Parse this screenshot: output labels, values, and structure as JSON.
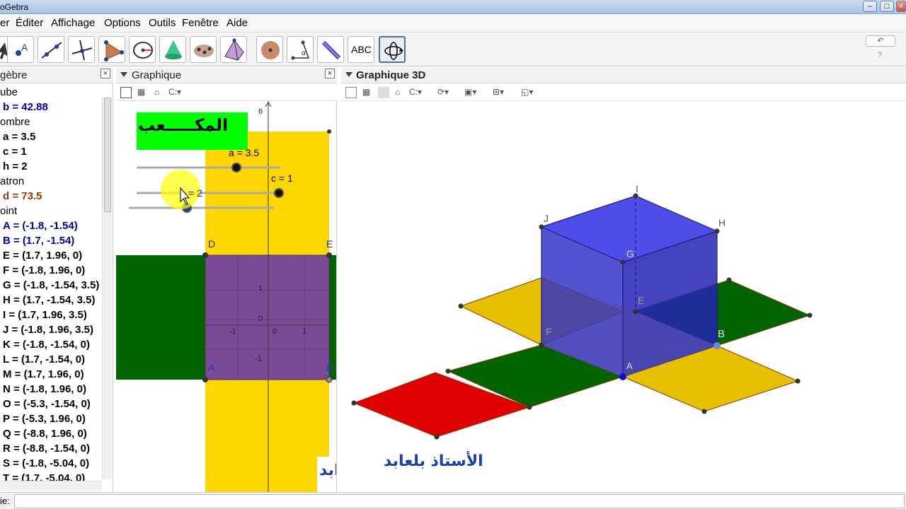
{
  "window": {
    "title": "oGebra"
  },
  "menu": [
    "er",
    "Éditer",
    "Affichage",
    "Options",
    "Outils",
    "Fenêtre",
    "Aide"
  ],
  "toolbar": {
    "abc_label": "ABC",
    "tools": [
      "move-tool",
      "point-tool",
      "line-tool",
      "perpendicular-tool",
      "polygon-tool",
      "circle-tool",
      "cone-tool",
      "conic-tool",
      "pyramid-tool",
      "sphere-tool",
      "angle-tool",
      "reflect-tool",
      "text-tool",
      "rotate-view-tool"
    ]
  },
  "algebra": {
    "title": "gèbre",
    "rows": [
      {
        "text": "ube",
        "style": "cat"
      },
      {
        "text": "b = 42.88",
        "style": "blue"
      },
      {
        "text": "ombre",
        "style": "cat"
      },
      {
        "text": "a = 3.5",
        "style": "black"
      },
      {
        "text": "c = 1",
        "style": "black"
      },
      {
        "text": "h = 2",
        "style": "black"
      },
      {
        "text": "atron",
        "style": "cat"
      },
      {
        "text": "d = 73.5",
        "style": "brown"
      },
      {
        "text": "oint",
        "style": "cat"
      },
      {
        "text": "A = (-1.8, -1.54)",
        "style": "blue"
      },
      {
        "text": "B = (1.7, -1.54)",
        "style": "blue"
      },
      {
        "text": "E = (1.7, 1.96, 0)",
        "style": "black"
      },
      {
        "text": "F = (-1.8, 1.96, 0)",
        "style": "black"
      },
      {
        "text": "G = (-1.8, -1.54, 3.5)",
        "style": "black"
      },
      {
        "text": "H = (1.7, -1.54, 3.5)",
        "style": "black"
      },
      {
        "text": "I = (1.7, 1.96, 3.5)",
        "style": "black"
      },
      {
        "text": "J = (-1.8, 1.96, 3.5)",
        "style": "black"
      },
      {
        "text": "K = (-1.8, -1.54, 0)",
        "style": "black"
      },
      {
        "text": "L = (1.7, -1.54, 0)",
        "style": "black"
      },
      {
        "text": "M = (1.7, 1.96, 0)",
        "style": "black"
      },
      {
        "text": "N = (-1.8, 1.96, 0)",
        "style": "black"
      },
      {
        "text": "O = (-5.3, -1.54, 0)",
        "style": "black"
      },
      {
        "text": "P = (-5.3, 1.96, 0)",
        "style": "black"
      },
      {
        "text": "Q = (-8.8, 1.96, 0)",
        "style": "black"
      },
      {
        "text": "R = (-8.8, -1.54, 0)",
        "style": "black"
      },
      {
        "text": "S = (-1.8, -5.04, 0)",
        "style": "black"
      },
      {
        "text": "T = (1.7, -5.04, 0)",
        "style": "black"
      }
    ]
  },
  "graphique2d": {
    "title": "Graphique",
    "banner_text": "المكـــــعب",
    "slider_a_label": "a = 3.5",
    "slider_c_label": "c = 1",
    "slider_h_label": "= 2",
    "label_D": "D",
    "label_E": "E",
    "label_A": "A",
    "label_B": "B",
    "axis_label_6": "6",
    "axis_label_1": "1",
    "axis_label_0": "0",
    "axis_label_m1": "-1",
    "axis_label_x0": "0",
    "axis_label_x1": "1",
    "axis_label_xm1": "-1",
    "partial_signature": "ابد",
    "sliders": {
      "a": 3.5,
      "c": 1,
      "h": 2
    },
    "colors": {
      "yellow": "#ffd700",
      "green": "#006400",
      "purple": "#7a4a96",
      "banner": "#00ff00"
    }
  },
  "graphique3d": {
    "title": "Graphique 3D",
    "label_I": "I",
    "label_J": "J",
    "label_H": "H",
    "label_G": "G",
    "label_E": "E",
    "label_F": "F",
    "label_A": "A",
    "label_B": "B",
    "signature": "الأستاذ بلعابد",
    "colors": {
      "cube": "#2e2ee6",
      "yellow": "#e6c000",
      "green": "#006400",
      "red": "#e00000"
    }
  },
  "inputbar": {
    "label": "ie:"
  }
}
